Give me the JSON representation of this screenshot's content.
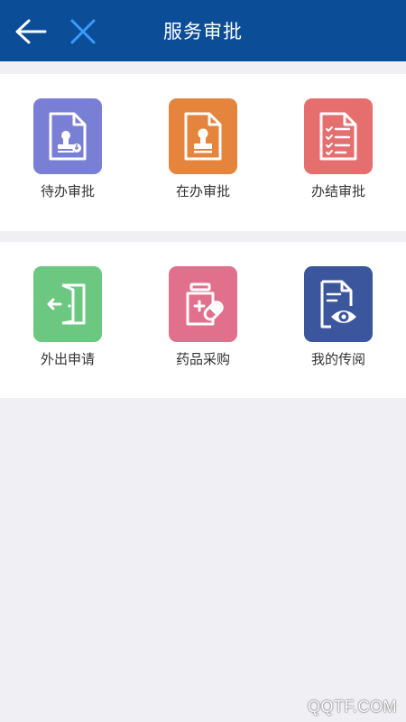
{
  "header": {
    "title": "服务审批",
    "background_color": "#0b4d97",
    "back_icon": "arrow-left-icon",
    "close_icon": "close-icon",
    "close_icon_color": "#3a9bff"
  },
  "section_1": {
    "items": [
      {
        "label": "待办审批",
        "icon": "document-stamp-icon",
        "color": "#7a7fd6"
      },
      {
        "label": "在办审批",
        "icon": "document-stamp-icon",
        "color": "#e5853d"
      },
      {
        "label": "办结审批",
        "icon": "checklist-icon",
        "color": "#e56e6e"
      }
    ]
  },
  "section_2": {
    "items": [
      {
        "label": "外出申请",
        "icon": "exit-door-icon",
        "color": "#6cc880"
      },
      {
        "label": "药品采购",
        "icon": "medicine-icon",
        "color": "#e0708c"
      },
      {
        "label": "我的传阅",
        "icon": "document-view-icon",
        "color": "#3b569c"
      }
    ]
  },
  "watermark": "QQTF.COM"
}
